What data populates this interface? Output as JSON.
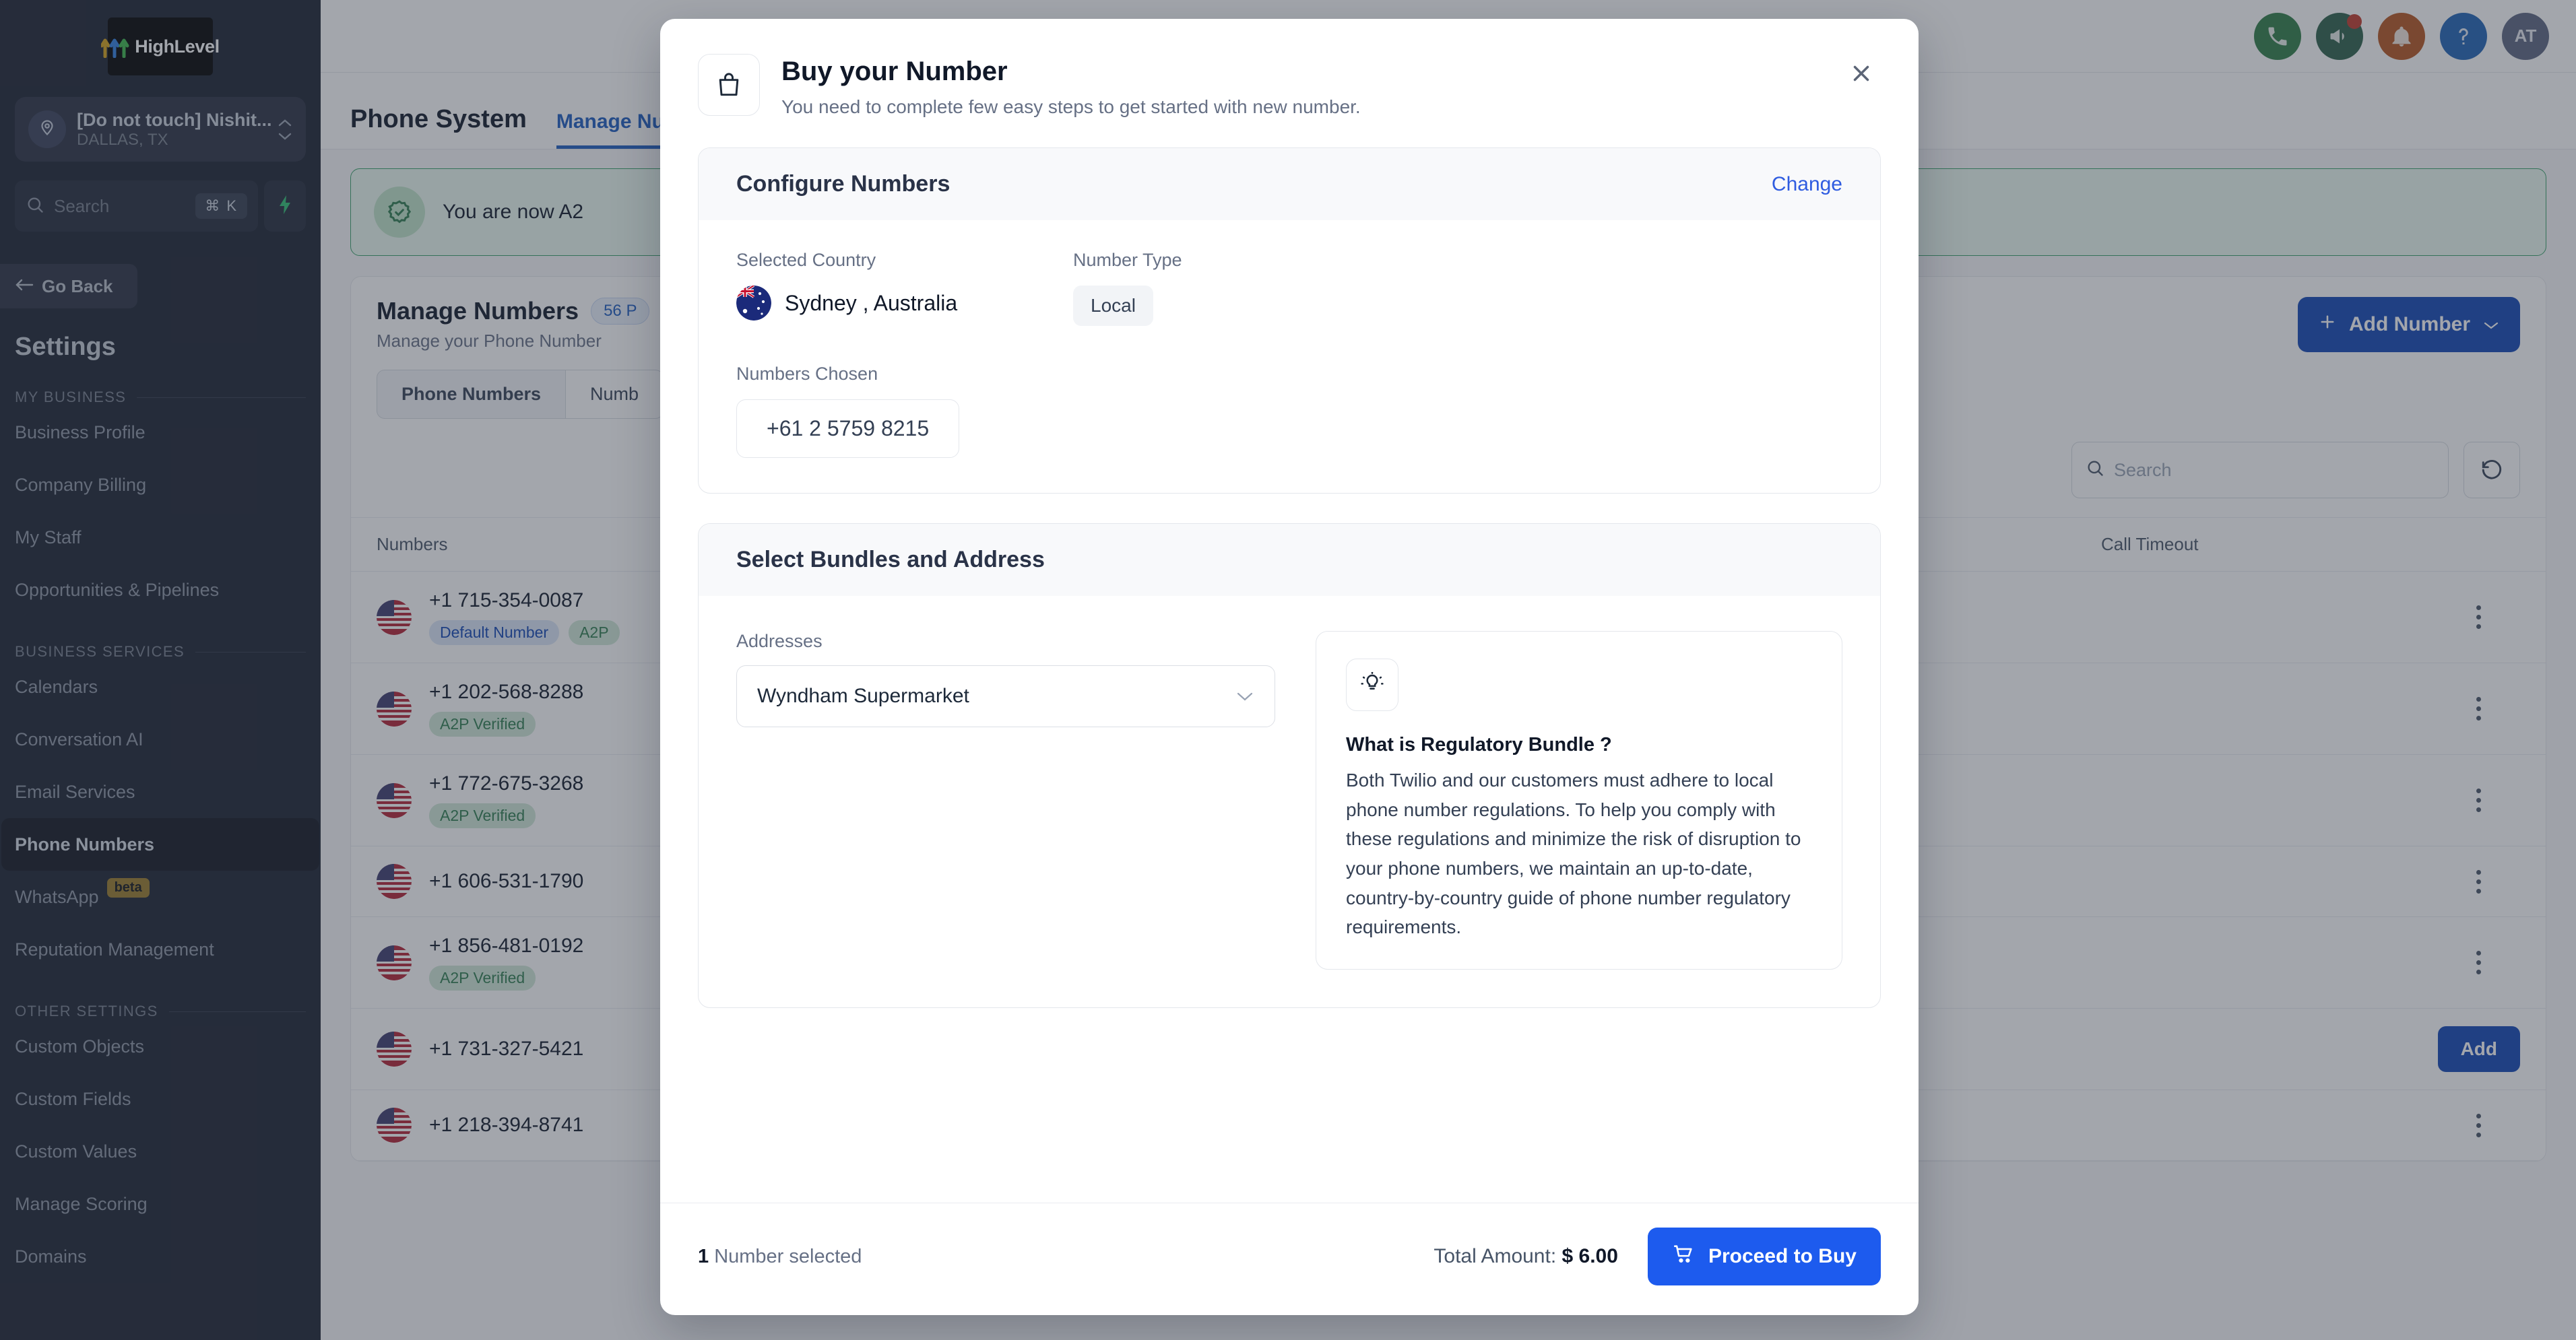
{
  "sidebar": {
    "brand": "HighLevel",
    "location": {
      "name": "[Do not touch] Nishit...",
      "sub": "DALLAS, TX"
    },
    "search": {
      "placeholder": "Search",
      "shortcut": "⌘ K"
    },
    "go_back": "Go Back",
    "title": "Settings",
    "groups": [
      {
        "label": "MY BUSINESS",
        "items": [
          {
            "label": "Business Profile",
            "active": false
          },
          {
            "label": "Company Billing",
            "active": false
          },
          {
            "label": "My Staff",
            "active": false
          },
          {
            "label": "Opportunities & Pipelines",
            "active": false
          }
        ]
      },
      {
        "label": "BUSINESS SERVICES",
        "items": [
          {
            "label": "Calendars",
            "active": false
          },
          {
            "label": "Conversation AI",
            "active": false
          },
          {
            "label": "Email Services",
            "active": false
          },
          {
            "label": "Phone Numbers",
            "active": true
          },
          {
            "label": "WhatsApp",
            "active": false,
            "badge": "beta"
          },
          {
            "label": "Reputation Management",
            "active": false
          }
        ]
      },
      {
        "label": "OTHER SETTINGS",
        "items": [
          {
            "label": "Custom Objects",
            "active": false
          },
          {
            "label": "Custom Fields",
            "active": false
          },
          {
            "label": "Custom Values",
            "active": false
          },
          {
            "label": "Manage Scoring",
            "active": false
          },
          {
            "label": "Domains",
            "active": false
          }
        ]
      }
    ]
  },
  "topbar": {
    "icons": [
      "phone-icon",
      "megaphone-icon",
      "bell-icon",
      "help-icon"
    ],
    "avatar_initials": "AT"
  },
  "page": {
    "title": "Phone System",
    "tabs": [
      {
        "label": "Manage Numbers",
        "active": true
      }
    ],
    "banner": {
      "text": "You are now A2"
    },
    "manage": {
      "title": "Manage Numbers",
      "count_pill": "56 P",
      "subtitle": "Manage your Phone Number",
      "add_button": "Add Number"
    },
    "subtabs": [
      {
        "label": "Phone Numbers",
        "active": true
      },
      {
        "label": "Numb",
        "active": false
      }
    ],
    "toolbar": {
      "search_placeholder": "Search",
      "refresh_icon": "refresh-icon"
    },
    "table": {
      "columns": [
        "Numbers",
        "Call Timeout"
      ],
      "rows": [
        {
          "number": "+1 715-354-0087",
          "badges": [
            "Default Number",
            "A2P"
          ]
        },
        {
          "number": "+1 202-568-8288",
          "badges": [
            "A2P Verified"
          ]
        },
        {
          "number": "+1 772-675-3268",
          "badges": [
            "A2P Verified"
          ]
        },
        {
          "number": "+1 606-531-1790",
          "badges": []
        },
        {
          "number": "+1 856-481-0192",
          "badges": [
            "A2P Verified"
          ]
        },
        {
          "number": "+1 731-327-5421",
          "badges": []
        },
        {
          "number": "+1 218-394-8741",
          "badges": []
        }
      ]
    },
    "add_small": "Add"
  },
  "modal": {
    "icon": "shopping-bag-icon",
    "title": "Buy your Number",
    "subtitle": "You need to complete few easy steps to get started with new number.",
    "close_icon": "close-icon",
    "configure": {
      "heading": "Configure Numbers",
      "change_link": "Change",
      "country_label": "Selected Country",
      "country_value": "Sydney , Australia",
      "number_type_label": "Number Type",
      "number_type_value": "Local",
      "numbers_chosen_label": "Numbers Chosen",
      "numbers_chosen": [
        "+61 2 5759 8215"
      ]
    },
    "bundles": {
      "heading": "Select Bundles and Address",
      "addresses_label": "Addresses",
      "address_value": "Wyndham Supermarket",
      "info": {
        "icon": "lightbulb-icon",
        "title": "What is Regulatory Bundle ?",
        "body": "Both Twilio and our customers must adhere to local phone number regulations. To help you comply with these regulations and minimize the risk of disruption to your phone numbers, we maintain an up-to-date, country-by-country guide of phone number regulatory requirements."
      }
    },
    "footer": {
      "selected_count": "1",
      "selected_label": " Number selected",
      "total_label": "Total Amount:",
      "total_value": "$ 6.00",
      "buy_button": "Proceed to Buy"
    }
  },
  "colors": {
    "accent_blue": "#1d5bee",
    "brand_dark": "#1b2130",
    "success_green": "#38a169"
  }
}
